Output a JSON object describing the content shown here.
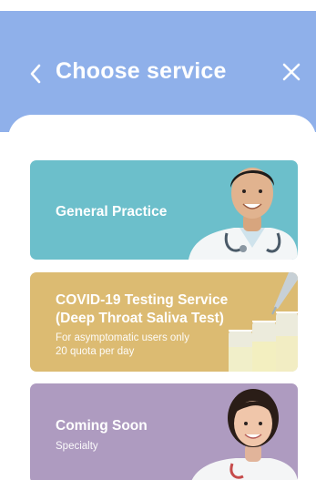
{
  "header": {
    "title": "Choose service",
    "back_icon": "chevron-left-icon",
    "close_icon": "close-icon",
    "background_color": "#8fb0ea"
  },
  "services": [
    {
      "title": "General Practice",
      "subtitle_lines": [],
      "color": "#6cbfcb",
      "image": "doctor-male-photo"
    },
    {
      "title_lines": [
        "COVID-19 Testing Service",
        "(Deep Throat Saliva Test)"
      ],
      "subtitle_lines": [
        "For asymptomatic users only",
        "20 quota per day"
      ],
      "color": "#dcbb72",
      "image": "test-tubes-photo"
    },
    {
      "title": "Coming Soon",
      "subtitle_lines": [
        "Specialty"
      ],
      "color": "#ae9bc0",
      "image": "doctor-female-photo"
    }
  ]
}
